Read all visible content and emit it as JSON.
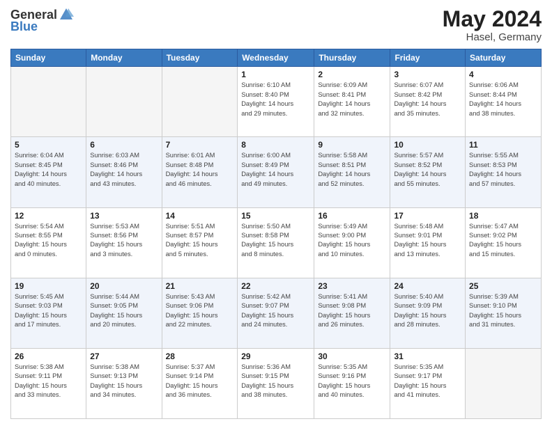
{
  "header": {
    "logo_general": "General",
    "logo_blue": "Blue",
    "title": "May 2024",
    "location": "Hasel, Germany"
  },
  "days_of_week": [
    "Sunday",
    "Monday",
    "Tuesday",
    "Wednesday",
    "Thursday",
    "Friday",
    "Saturday"
  ],
  "weeks": [
    [
      {
        "day": "",
        "info": ""
      },
      {
        "day": "",
        "info": ""
      },
      {
        "day": "",
        "info": ""
      },
      {
        "day": "1",
        "info": "Sunrise: 6:10 AM\nSunset: 8:40 PM\nDaylight: 14 hours\nand 29 minutes."
      },
      {
        "day": "2",
        "info": "Sunrise: 6:09 AM\nSunset: 8:41 PM\nDaylight: 14 hours\nand 32 minutes."
      },
      {
        "day": "3",
        "info": "Sunrise: 6:07 AM\nSunset: 8:42 PM\nDaylight: 14 hours\nand 35 minutes."
      },
      {
        "day": "4",
        "info": "Sunrise: 6:06 AM\nSunset: 8:44 PM\nDaylight: 14 hours\nand 38 minutes."
      }
    ],
    [
      {
        "day": "5",
        "info": "Sunrise: 6:04 AM\nSunset: 8:45 PM\nDaylight: 14 hours\nand 40 minutes."
      },
      {
        "day": "6",
        "info": "Sunrise: 6:03 AM\nSunset: 8:46 PM\nDaylight: 14 hours\nand 43 minutes."
      },
      {
        "day": "7",
        "info": "Sunrise: 6:01 AM\nSunset: 8:48 PM\nDaylight: 14 hours\nand 46 minutes."
      },
      {
        "day": "8",
        "info": "Sunrise: 6:00 AM\nSunset: 8:49 PM\nDaylight: 14 hours\nand 49 minutes."
      },
      {
        "day": "9",
        "info": "Sunrise: 5:58 AM\nSunset: 8:51 PM\nDaylight: 14 hours\nand 52 minutes."
      },
      {
        "day": "10",
        "info": "Sunrise: 5:57 AM\nSunset: 8:52 PM\nDaylight: 14 hours\nand 55 minutes."
      },
      {
        "day": "11",
        "info": "Sunrise: 5:55 AM\nSunset: 8:53 PM\nDaylight: 14 hours\nand 57 minutes."
      }
    ],
    [
      {
        "day": "12",
        "info": "Sunrise: 5:54 AM\nSunset: 8:55 PM\nDaylight: 15 hours\nand 0 minutes."
      },
      {
        "day": "13",
        "info": "Sunrise: 5:53 AM\nSunset: 8:56 PM\nDaylight: 15 hours\nand 3 minutes."
      },
      {
        "day": "14",
        "info": "Sunrise: 5:51 AM\nSunset: 8:57 PM\nDaylight: 15 hours\nand 5 minutes."
      },
      {
        "day": "15",
        "info": "Sunrise: 5:50 AM\nSunset: 8:58 PM\nDaylight: 15 hours\nand 8 minutes."
      },
      {
        "day": "16",
        "info": "Sunrise: 5:49 AM\nSunset: 9:00 PM\nDaylight: 15 hours\nand 10 minutes."
      },
      {
        "day": "17",
        "info": "Sunrise: 5:48 AM\nSunset: 9:01 PM\nDaylight: 15 hours\nand 13 minutes."
      },
      {
        "day": "18",
        "info": "Sunrise: 5:47 AM\nSunset: 9:02 PM\nDaylight: 15 hours\nand 15 minutes."
      }
    ],
    [
      {
        "day": "19",
        "info": "Sunrise: 5:45 AM\nSunset: 9:03 PM\nDaylight: 15 hours\nand 17 minutes."
      },
      {
        "day": "20",
        "info": "Sunrise: 5:44 AM\nSunset: 9:05 PM\nDaylight: 15 hours\nand 20 minutes."
      },
      {
        "day": "21",
        "info": "Sunrise: 5:43 AM\nSunset: 9:06 PM\nDaylight: 15 hours\nand 22 minutes."
      },
      {
        "day": "22",
        "info": "Sunrise: 5:42 AM\nSunset: 9:07 PM\nDaylight: 15 hours\nand 24 minutes."
      },
      {
        "day": "23",
        "info": "Sunrise: 5:41 AM\nSunset: 9:08 PM\nDaylight: 15 hours\nand 26 minutes."
      },
      {
        "day": "24",
        "info": "Sunrise: 5:40 AM\nSunset: 9:09 PM\nDaylight: 15 hours\nand 28 minutes."
      },
      {
        "day": "25",
        "info": "Sunrise: 5:39 AM\nSunset: 9:10 PM\nDaylight: 15 hours\nand 31 minutes."
      }
    ],
    [
      {
        "day": "26",
        "info": "Sunrise: 5:38 AM\nSunset: 9:11 PM\nDaylight: 15 hours\nand 33 minutes."
      },
      {
        "day": "27",
        "info": "Sunrise: 5:38 AM\nSunset: 9:13 PM\nDaylight: 15 hours\nand 34 minutes."
      },
      {
        "day": "28",
        "info": "Sunrise: 5:37 AM\nSunset: 9:14 PM\nDaylight: 15 hours\nand 36 minutes."
      },
      {
        "day": "29",
        "info": "Sunrise: 5:36 AM\nSunset: 9:15 PM\nDaylight: 15 hours\nand 38 minutes."
      },
      {
        "day": "30",
        "info": "Sunrise: 5:35 AM\nSunset: 9:16 PM\nDaylight: 15 hours\nand 40 minutes."
      },
      {
        "day": "31",
        "info": "Sunrise: 5:35 AM\nSunset: 9:17 PM\nDaylight: 15 hours\nand 41 minutes."
      },
      {
        "day": "",
        "info": ""
      }
    ]
  ]
}
